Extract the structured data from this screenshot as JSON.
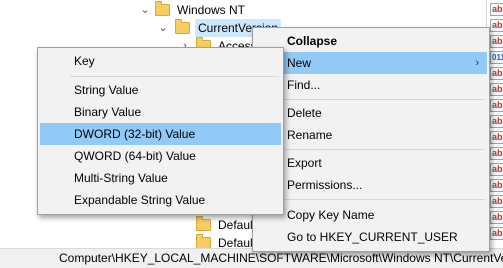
{
  "tree": {
    "windows_nt": "Windows NT",
    "current_version": "CurrentVersion",
    "accessibility": "Accessibility",
    "default_1": "Default",
    "default_2": "Default"
  },
  "value_pane": {
    "icons": [
      "ab",
      "ab",
      "ab",
      "011",
      "ab",
      "ab",
      "ab",
      "ab",
      "ab",
      "ab",
      "ab",
      "ab",
      "ab",
      "ab",
      "ab",
      "ab"
    ]
  },
  "statusbar": {
    "path": "Computer\\HKEY_LOCAL_MACHINE\\SOFTWARE\\Microsoft\\Windows NT\\CurrentVersion"
  },
  "context_menu": {
    "items": [
      {
        "label": "Collapse"
      },
      {
        "label": "New",
        "submenu_arrow": "›"
      },
      {
        "label": "Find..."
      },
      {
        "label": "Delete"
      },
      {
        "label": "Rename"
      },
      {
        "label": "Export"
      },
      {
        "label": "Permissions..."
      },
      {
        "label": "Copy Key Name"
      },
      {
        "label": "Go to HKEY_CURRENT_USER"
      }
    ]
  },
  "new_submenu": {
    "items": [
      {
        "label": "Key"
      },
      {
        "label": "String Value"
      },
      {
        "label": "Binary Value"
      },
      {
        "label": "DWORD (32-bit) Value"
      },
      {
        "label": "QWORD (64-bit) Value"
      },
      {
        "label": "Multi-String Value"
      },
      {
        "label": "Expandable String Value"
      }
    ]
  },
  "colors": {
    "highlight": "#91c9f7",
    "selection": "#cce8ff",
    "menu_bg": "#f2f2f2",
    "folder": "#f5cd62"
  }
}
